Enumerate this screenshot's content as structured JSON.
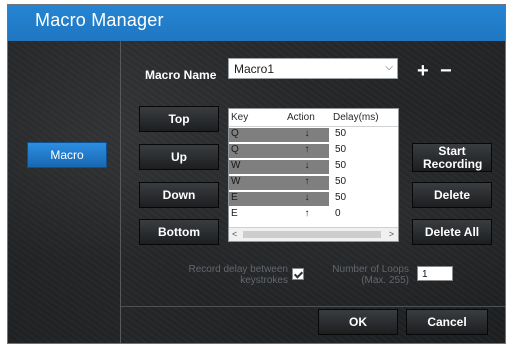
{
  "window": {
    "title": "Macro Manager"
  },
  "sidebar": {
    "macro_tab": "Macro"
  },
  "macro_name": {
    "label": "Macro Name",
    "value": "Macro1",
    "add": "+",
    "remove": "−"
  },
  "order_buttons": {
    "top": "Top",
    "up": "Up",
    "down": "Down",
    "bottom": "Bottom"
  },
  "table": {
    "headers": {
      "key": "Key",
      "action": "Action",
      "delay": "Delay(ms)"
    },
    "rows": [
      {
        "key": "Q",
        "action": "↓",
        "delay": "50"
      },
      {
        "key": "Q",
        "action": "↑",
        "delay": "50"
      },
      {
        "key": "W",
        "action": "↓",
        "delay": "50"
      },
      {
        "key": "W",
        "action": "↑",
        "delay": "50"
      },
      {
        "key": "E",
        "action": "↓",
        "delay": "50"
      },
      {
        "key": "E",
        "action": "↑",
        "delay": "0"
      }
    ],
    "scroll_left": "<",
    "scroll_right": ">"
  },
  "actions": {
    "start_recording": "Start Recording",
    "delete": "Delete",
    "delete_all": "Delete All"
  },
  "options": {
    "record_delay": "Record delay between keystrokes",
    "record_delay_checked": true,
    "loops_label": "Number of Loops (Max. 255)",
    "loops_value": "1"
  },
  "footer": {
    "ok": "OK",
    "cancel": "Cancel"
  }
}
